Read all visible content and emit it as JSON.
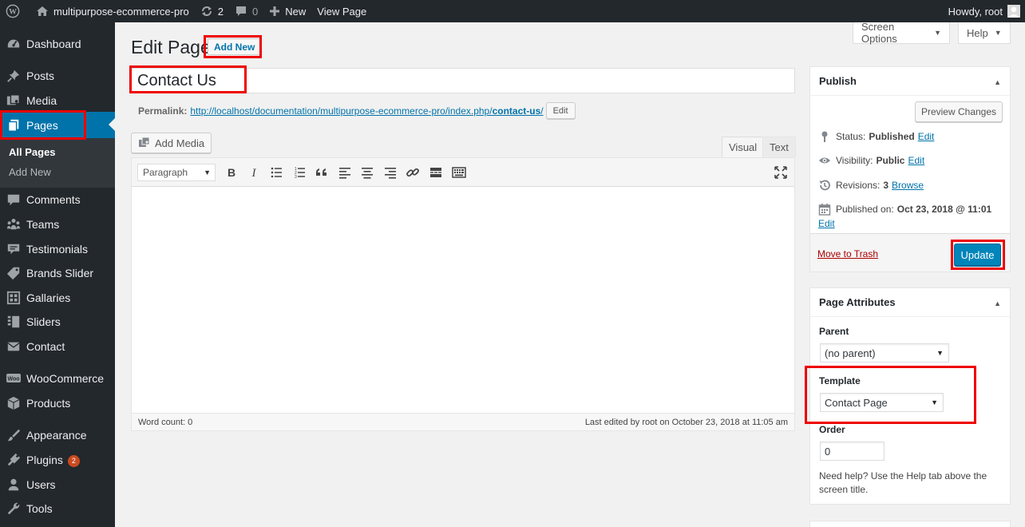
{
  "admin_bar": {
    "site_name": "multipurpose-ecommerce-pro",
    "updates_count": "2",
    "comments_count": "0",
    "new_label": "New",
    "view_page_label": "View Page",
    "greeting": "Howdy, root"
  },
  "sidebar": {
    "items": [
      {
        "label": "Dashboard",
        "icon": "dashboard-icon"
      },
      {
        "label": "Posts",
        "icon": "pin-icon"
      },
      {
        "label": "Media",
        "icon": "media-icon"
      },
      {
        "label": "Pages",
        "icon": "pages-icon"
      },
      {
        "label": "Comments",
        "icon": "comment-icon"
      },
      {
        "label": "Teams",
        "icon": "groups-icon"
      },
      {
        "label": "Testimonials",
        "icon": "testimonial-icon"
      },
      {
        "label": "Brands Slider",
        "icon": "tag-icon"
      },
      {
        "label": "Gallaries",
        "icon": "gallery-icon"
      },
      {
        "label": "Sliders",
        "icon": "slides-icon"
      },
      {
        "label": "Contact",
        "icon": "email-icon"
      },
      {
        "label": "WooCommerce",
        "icon": "woocommerce-icon"
      },
      {
        "label": "Products",
        "icon": "products-icon"
      },
      {
        "label": "Appearance",
        "icon": "brush-icon"
      },
      {
        "label": "Plugins",
        "icon": "plugin-icon",
        "badge": "2"
      },
      {
        "label": "Users",
        "icon": "users-icon"
      },
      {
        "label": "Tools",
        "icon": "wrench-icon"
      }
    ],
    "submenu": [
      "All Pages",
      "Add New"
    ]
  },
  "screen_options_label": "Screen Options",
  "help_label": "Help",
  "heading": {
    "title": "Edit Page",
    "add_new": "Add New"
  },
  "post_title": "Contact Us",
  "permalink": {
    "label": "Permalink:",
    "url_base": "http://localhost/documentation/multipurpose-ecommerce-pro/index.php/",
    "slug": "contact-us",
    "url_end": "/",
    "edit_label": "Edit"
  },
  "editor": {
    "add_media": "Add Media",
    "tab_visual": "Visual",
    "tab_text": "Text",
    "format": "Paragraph",
    "word_count": "Word count: 0",
    "last_edited": "Last edited by root on October 23, 2018 at 11:05 am"
  },
  "publish": {
    "title": "Publish",
    "preview": "Preview Changes",
    "status_label": "Status:",
    "status_value": "Published",
    "visibility_label": "Visibility:",
    "visibility_value": "Public",
    "revisions_label": "Revisions:",
    "revisions_value": "3",
    "browse": "Browse",
    "published_label": "Published on:",
    "published_value": "Oct 23, 2018 @ 11:01",
    "edit": "Edit",
    "trash": "Move to Trash",
    "update": "Update"
  },
  "page_attributes": {
    "title": "Page Attributes",
    "parent_label": "Parent",
    "parent_value": "(no parent)",
    "template_label": "Template",
    "template_value": "Contact Page",
    "order_label": "Order",
    "order_value": "0",
    "help": "Need help? Use the Help tab above the screen title."
  },
  "colors": {
    "admin_dark": "#23282d",
    "accent": "#0073aa",
    "primary_button": "#0085ba",
    "highlight_box": "#e00000",
    "trash": "#a00000"
  }
}
